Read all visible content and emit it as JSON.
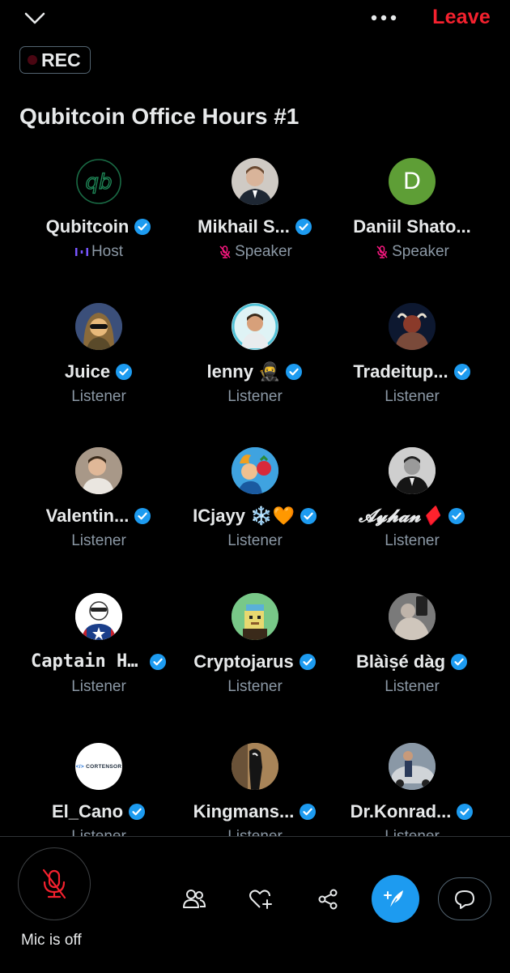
{
  "header": {
    "leave_label": "Leave",
    "collapse_icon": "chevron-down-icon",
    "more_icon": "more-horizontal-icon"
  },
  "rec_badge": {
    "label": "REC"
  },
  "space": {
    "title": "Qubitcoin Office Hours #1"
  },
  "participants": [
    {
      "name": "Qubitcoin",
      "verified": true,
      "role": "Host",
      "role_icon": "host-bars-icon"
    },
    {
      "name": "Mikhail S...",
      "verified": true,
      "role": "Speaker",
      "role_icon": "mic-off-icon"
    },
    {
      "name": "Daniil Shato...",
      "verified": false,
      "role": "Speaker",
      "role_icon": "mic-off-icon",
      "avatar_letter": "D"
    },
    {
      "name": "Juice",
      "verified": true,
      "role": "Listener"
    },
    {
      "name": "lenny 🥷",
      "verified": true,
      "role": "Listener"
    },
    {
      "name": "Tradeitup...",
      "verified": true,
      "role": "Listener"
    },
    {
      "name": "Valentin...",
      "verified": true,
      "role": "Listener"
    },
    {
      "name": "ICjayy ❄️🧡",
      "verified": true,
      "role": "Listener"
    },
    {
      "name": "𝓐𝔂𝓱𝓪𝓷♦️",
      "verified": true,
      "role": "Listener"
    },
    {
      "name": "Captain H...",
      "verified": true,
      "role": "Listener"
    },
    {
      "name": "Cryptojarus",
      "verified": true,
      "role": "Listener"
    },
    {
      "name": "Blàìṣé dàg",
      "verified": true,
      "role": "Listener"
    },
    {
      "name": "El_Cano",
      "verified": true,
      "role": "Listener",
      "avatar_text": "CORTENSOR"
    },
    {
      "name": "Kingmans...",
      "verified": true,
      "role": "Listener"
    },
    {
      "name": "Dr.Konrad...",
      "verified": true,
      "role": "Listener"
    }
  ],
  "bottom_bar": {
    "mic_label": "Mic is off",
    "buttons": [
      "people-icon",
      "heart-add-icon",
      "share-icon",
      "compose-icon",
      "chat-bubble-icon"
    ]
  },
  "colors": {
    "accent": "#1d9bf0",
    "leave": "#f4212e",
    "host": "#7856ff",
    "muted_mic": "#f91880",
    "muted_text": "#8b98a5"
  }
}
